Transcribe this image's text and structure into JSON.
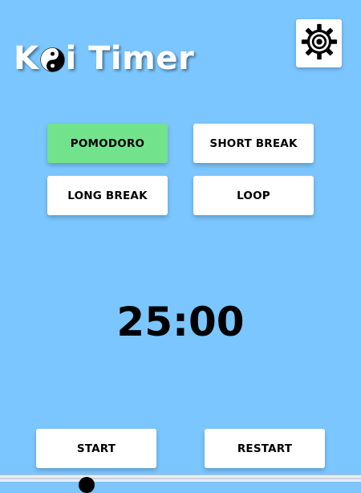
{
  "app": {
    "title_prefix": "K",
    "title_suffix": "i Timer",
    "logo_icon": "yin-yang-icon",
    "settings_icon": "gear-icon"
  },
  "modes": {
    "pomodoro": "POMODORO",
    "short_break": "SHORT BREAK",
    "long_break": "LONG BREAK",
    "loop": "LOOP",
    "active": "pomodoro"
  },
  "timer": {
    "display": "25:00"
  },
  "controls": {
    "start": "START",
    "restart": "RESTART"
  },
  "progress": {
    "value": 0.24
  },
  "colors": {
    "background": "#7bc6ff",
    "active_mode": "#72e38d",
    "button": "#ffffff",
    "text": "#000000"
  }
}
